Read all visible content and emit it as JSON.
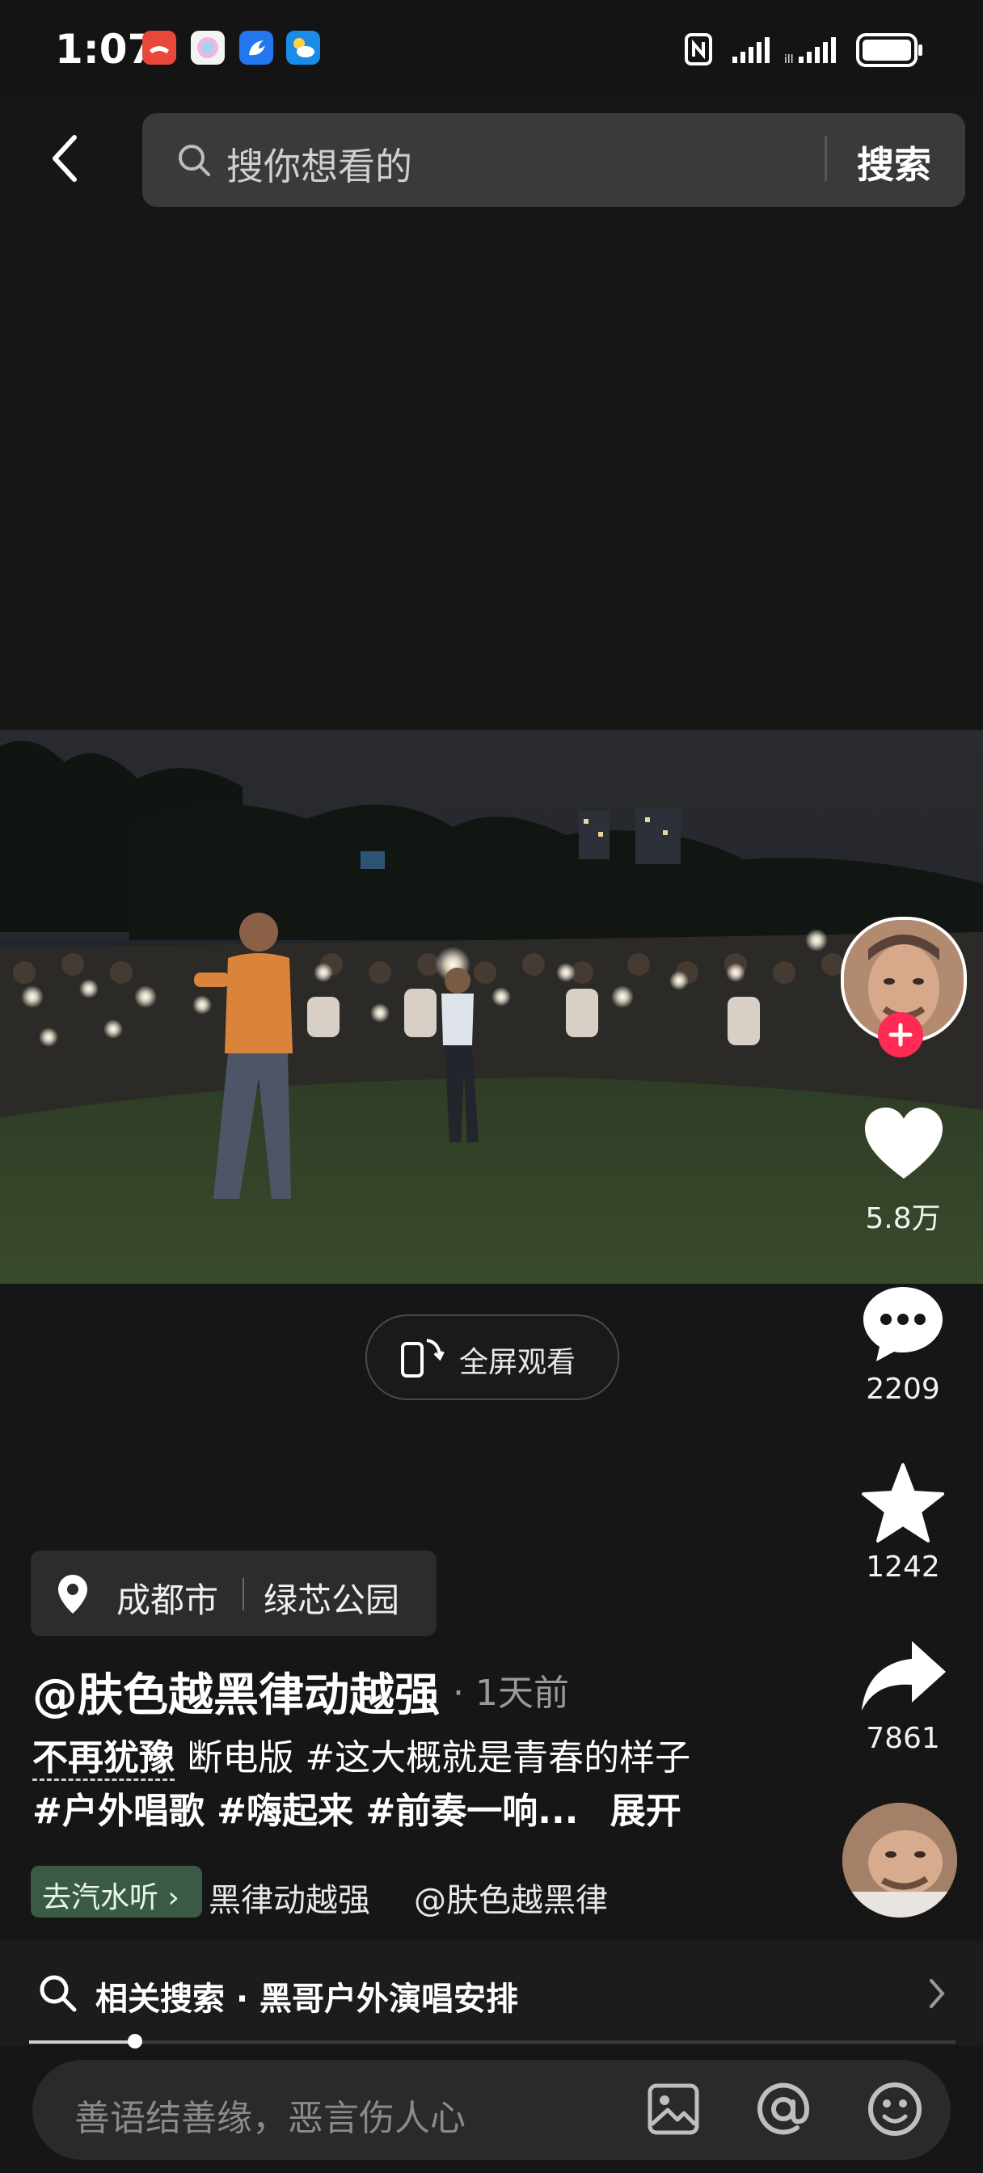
{
  "status_bar": {
    "time": "1:07"
  },
  "search": {
    "placeholder": "搜你想看的",
    "button": "搜索"
  },
  "video": {
    "fullscreen_label": "全屏观看"
  },
  "actions": {
    "likes": "5.8万",
    "comments": "2209",
    "favorites": "1242",
    "shares": "7861"
  },
  "location": {
    "city": "成都市",
    "place": "绿芯公园"
  },
  "post": {
    "author": "@肤色越黑律动越强",
    "time_ago": "· 1天前",
    "song_link": "不再犹豫",
    "line1_rest": "断电版 #这大概就是青春的样子",
    "line2": "#户外唱歌 #嗨起来 #前奏一响...",
    "expand": "展开"
  },
  "music": {
    "tag": "去汽水听",
    "title": "黑律动越强",
    "artist": "@肤色越黑律"
  },
  "related": {
    "label": "相关搜索 · 黑哥户外演唱安排"
  },
  "comment_box": {
    "placeholder": "善语结善缘，恶言伤人心"
  },
  "colors": {
    "background": "#161616",
    "follow_badge": "#ff2b54",
    "music_tag": "#3b5a45"
  }
}
